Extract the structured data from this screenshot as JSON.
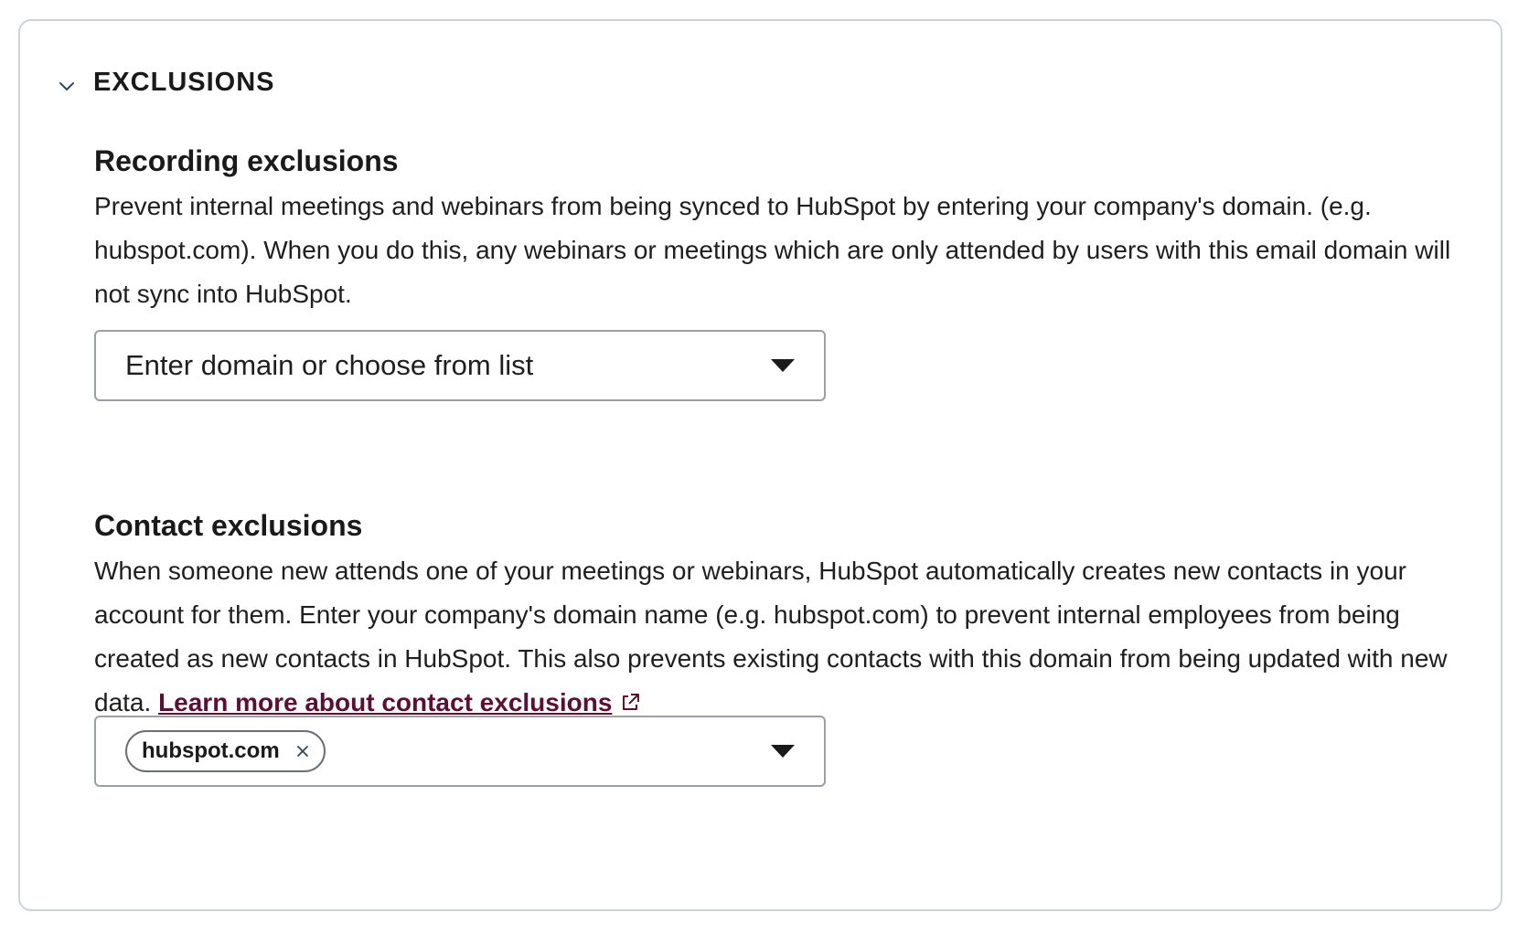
{
  "section": {
    "title": "EXCLUSIONS",
    "toggle_icon": "chevron-down-icon"
  },
  "recording": {
    "title": "Recording exclusions",
    "description": "Prevent internal meetings and webinars from being synced to HubSpot by entering your company's domain. (e.g. hubspot.com). When you do this, any webinars or meetings which are only attended by users with this email domain will not sync into HubSpot.",
    "select": {
      "placeholder": "Enter domain or choose from list",
      "icon": "caret-down-icon"
    }
  },
  "contact": {
    "title": "Contact exclusions",
    "description": "When someone new attends one of your meetings or webinars, HubSpot automatically creates new contacts in your account for them. Enter your company's domain name (e.g. hubspot.com) to prevent internal employees from being created as new contacts in HubSpot. This also prevents existing contacts with this domain from being updated with new data. ",
    "link_text": "Learn more about contact exclusions",
    "link_icon": "external-link-icon",
    "select": {
      "tags": [
        "hubspot.com"
      ],
      "tag_remove_icon": "close-icon",
      "icon": "caret-down-icon"
    }
  },
  "colors": {
    "link": "#5a0f34",
    "border": "#cfd3d7",
    "input_border": "#9aa0a6",
    "text": "#1f1f1f"
  }
}
